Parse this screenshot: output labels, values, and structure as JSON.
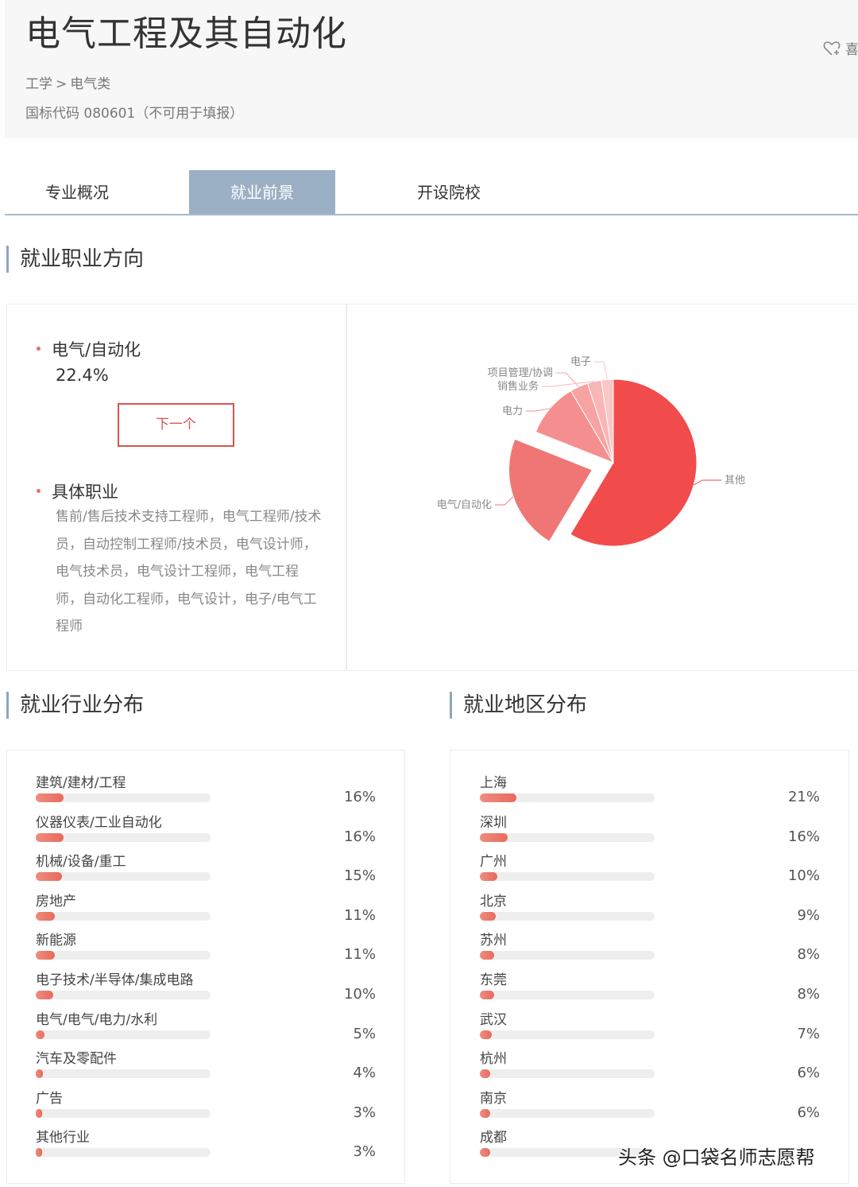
{
  "header": {
    "title": "电气工程及其自动化",
    "breadcrumb": {
      "category": "工学",
      "separator": ">",
      "subcategory": "电气类"
    },
    "code": "国标代码 080601（不可用于填报）",
    "favorite_label": "喜"
  },
  "tabs": [
    {
      "label": "专业概况",
      "active": false
    },
    {
      "label": "就业前景",
      "active": true
    },
    {
      "label": "开设院校",
      "active": false
    }
  ],
  "career": {
    "section_title": "就业职业方向",
    "current_direction": "电气/自动化",
    "current_percent": "22.4%",
    "next_button": "下一个",
    "jobs_heading": "具体职业",
    "jobs_text": "售前/售后技术支持工程师，电气工程师/技术员，自动控制工程师/技术员，电气设计师，电气技术员，电气设计工程师，电气工程师，自动化工程师，电气设计，电子/电气工程师"
  },
  "chart_data": {
    "type": "pie",
    "exploded": [
      "电气/自动化"
    ],
    "slices": [
      {
        "label": "其他",
        "value": 58.6,
        "color": "#f24b4b"
      },
      {
        "label": "电气/自动化",
        "value": 22.4,
        "color": "#f07676"
      },
      {
        "label": "电力",
        "value": 10.5,
        "color": "#f58f8f"
      },
      {
        "label": "项目管理/协调",
        "value": 3.5,
        "color": "#f7a3a3"
      },
      {
        "label": "销售业务",
        "value": 2.7,
        "color": "#f9b6b6"
      },
      {
        "label": "电子",
        "value": 2.3,
        "color": "#fac6c6"
      }
    ]
  },
  "industry": {
    "section_title": "就业行业分布",
    "items": [
      {
        "label": "建筑/建材/工程",
        "value": 16,
        "display": "16%"
      },
      {
        "label": "仪器仪表/工业自动化",
        "value": 16,
        "display": "16%"
      },
      {
        "label": "机械/设备/重工",
        "value": 15,
        "display": "15%"
      },
      {
        "label": "房地产",
        "value": 11,
        "display": "11%"
      },
      {
        "label": "新能源",
        "value": 11,
        "display": "11%"
      },
      {
        "label": "电子技术/半导体/集成电路",
        "value": 10,
        "display": "10%"
      },
      {
        "label": "电气/电气/电力/水利",
        "value": 5,
        "display": "5%"
      },
      {
        "label": "汽车及零配件",
        "value": 4,
        "display": "4%"
      },
      {
        "label": "广告",
        "value": 3,
        "display": "3%"
      },
      {
        "label": "其他行业",
        "value": 3,
        "display": "3%"
      }
    ]
  },
  "region": {
    "section_title": "就业地区分布",
    "items": [
      {
        "label": "上海",
        "value": 21,
        "display": "21%"
      },
      {
        "label": "深圳",
        "value": 16,
        "display": "16%"
      },
      {
        "label": "广州",
        "value": 10,
        "display": "10%"
      },
      {
        "label": "北京",
        "value": 9,
        "display": "9%"
      },
      {
        "label": "苏州",
        "value": 8,
        "display": "8%"
      },
      {
        "label": "东莞",
        "value": 8,
        "display": "8%"
      },
      {
        "label": "武汉",
        "value": 7,
        "display": "7%"
      },
      {
        "label": "杭州",
        "value": 6,
        "display": "6%"
      },
      {
        "label": "南京",
        "value": 6,
        "display": "6%"
      },
      {
        "label": "成都",
        "value": 6,
        "display": ""
      }
    ]
  },
  "watermark": "头条 @口袋名师志愿帮",
  "colors": {
    "accent": "#e86a5c",
    "tab_active": "#9bb0c4",
    "section_bar": "#8fa6bd",
    "button_border": "#d9534f"
  }
}
